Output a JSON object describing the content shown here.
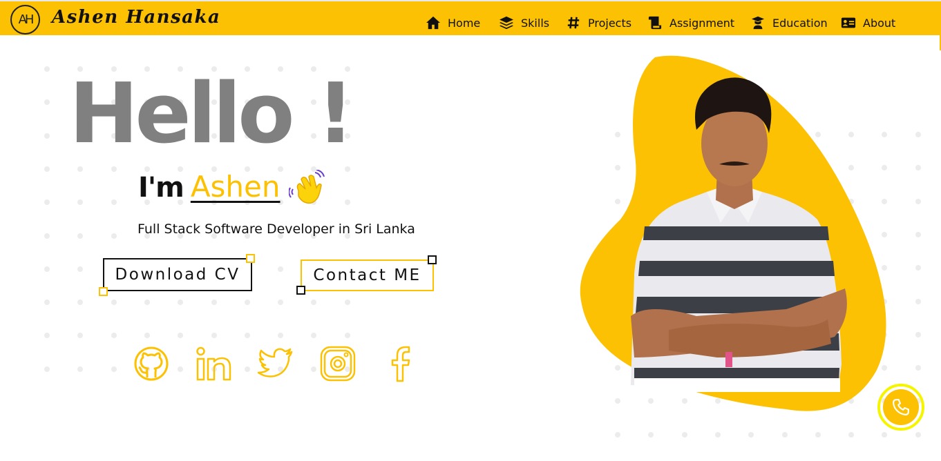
{
  "brand": {
    "logo_text": "AH",
    "name": "Ashen Hansaka"
  },
  "nav": {
    "items": [
      {
        "label": "Home",
        "icon": "home-icon"
      },
      {
        "label": "Skills",
        "icon": "layers-icon"
      },
      {
        "label": "Projects",
        "icon": "hashtag-icon"
      },
      {
        "label": "Assignment",
        "icon": "scroll-icon"
      },
      {
        "label": "Education",
        "icon": "graduate-icon"
      },
      {
        "label": "About",
        "icon": "id-card-icon"
      }
    ]
  },
  "hero": {
    "greeting": "Hello !",
    "intro": "I'm",
    "name": "Ashen",
    "wave_icon": "waving-hand-icon",
    "tagline": "Full Stack Software Developer in Sri Lanka",
    "download_cv_label": "Download CV",
    "contact_label": "Contact ME"
  },
  "social": [
    "github-icon",
    "linkedin-icon",
    "twitter-icon",
    "instagram-icon",
    "facebook-icon"
  ],
  "colors": {
    "accent": "#fbc102",
    "text": "#111111",
    "greeting": "#808080",
    "dots": "#ececec",
    "phone_ring": "#f5f500"
  },
  "floating": {
    "phone_icon": "phone-icon"
  }
}
